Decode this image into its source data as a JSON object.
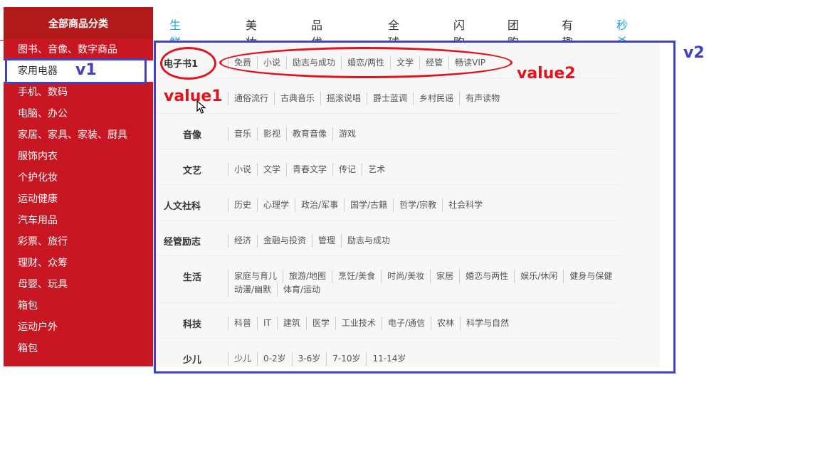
{
  "sidebar": {
    "title": "全部商品分类",
    "items": [
      "图书、音像、数字商品",
      "家用电器",
      "手机、数码",
      "电脑、办公",
      "家居、家具、家装、厨具",
      "服饰内衣",
      "个护化妆",
      "运动健康",
      "汽车用品",
      "彩票、旅行",
      "理财、众筹",
      "母婴、玩具",
      "箱包",
      "运动户外",
      "箱包"
    ],
    "active_index": 1
  },
  "nav": {
    "items": [
      "生鲜模块",
      "美妆馆",
      "品优超市",
      "全球购",
      "闪购",
      "团购",
      "有趣",
      "秒杀"
    ],
    "highlight": [
      0,
      7
    ]
  },
  "panel": {
    "rows": [
      {
        "title": "电子书1",
        "items": [
          "免费",
          "小说",
          "励志与成功",
          "婚恋/两性",
          "文学",
          "经管",
          "畅读VIP"
        ]
      },
      {
        "title": "",
        "items": [
          "通俗流行",
          "古典音乐",
          "摇滚说唱",
          "爵士蓝调",
          "乡村民谣",
          "有声读物"
        ]
      },
      {
        "title": "音像",
        "items": [
          "音乐",
          "影视",
          "教育音像",
          "游戏"
        ]
      },
      {
        "title": "文艺",
        "items": [
          "小说",
          "文学",
          "青春文学",
          "传记",
          "艺术"
        ]
      },
      {
        "title": "人文社科",
        "items": [
          "历史",
          "心理学",
          "政治/军事",
          "国学/古籍",
          "哲学/宗教",
          "社会科学"
        ]
      },
      {
        "title": "经管励志",
        "items": [
          "经济",
          "金融与投资",
          "管理",
          "励志与成功"
        ]
      },
      {
        "title": "生活",
        "items": [
          "家庭与育儿",
          "旅游/地图",
          "烹饪/美食",
          "时尚/美妆",
          "家居",
          "婚恋与两性",
          "娱乐/休闲",
          "健身与保健",
          "动漫/幽默",
          "体育/运动"
        ]
      },
      {
        "title": "科技",
        "items": [
          "科普",
          "IT",
          "建筑",
          "医学",
          "工业技术",
          "电子/通信",
          "农林",
          "科学与自然"
        ]
      },
      {
        "title": "少儿",
        "items": [
          "少儿",
          "0-2岁",
          "3-6岁",
          "7-10岁",
          "11-14岁"
        ]
      }
    ]
  },
  "annotations": {
    "v1": "v1",
    "v2": "v2",
    "value1": "value1",
    "value2": "value2"
  },
  "colors": {
    "sidebar_bg": "#c81623",
    "sidebar_head_bg": "#b1191a",
    "nav_highlight": "#1ba1e2",
    "annotation_blue": "#4242c8",
    "annotation_red": "#e0141e"
  }
}
